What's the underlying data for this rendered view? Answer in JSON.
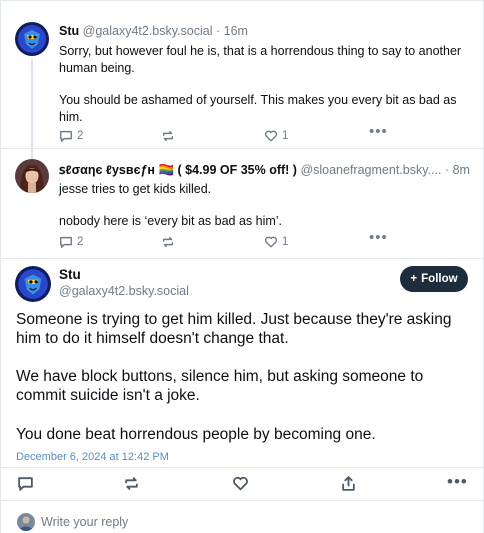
{
  "post1": {
    "name": "Stu",
    "handle": "@galaxy4t2.bsky.social",
    "dot": "·",
    "time": "16m",
    "paragraph1": "Sorry, but however foul he is, that is a horrendous thing to say to another human being.",
    "paragraph2": "You should be ashamed of yourself. This makes you every bit as bad as him.",
    "reply_count": "2",
    "like_count": "1"
  },
  "post2": {
    "name": "ꜱℓσαηє ℓуѕвєƒн 🏳️‍🌈 ( $4.99 OF 35% off! )",
    "handle": "@sloanefragment.bsky....",
    "dot": "·",
    "time": "8m",
    "paragraph1": "jesse tries to get kids killed.",
    "paragraph2": "nobody here is ‘every bit as bad as him’.",
    "reply_count": "2",
    "like_count": "1"
  },
  "main_post": {
    "name": "Stu",
    "handle": "@galaxy4t2.bsky.social",
    "follow_label": "Follow",
    "paragraph1": "Someone is trying to get him killed. Just because they're asking him to do it himself doesn't change that.",
    "paragraph2": "We have block buttons, silence him, but asking someone to commit suicide isn't a joke.",
    "paragraph3": "You done beat horrendous people by becoming one.",
    "date": "December 6, 2024 at 12:42 PM"
  },
  "reply_bar": {
    "placeholder": "Write your reply"
  },
  "icons": {
    "reply": "comment-icon",
    "repost": "repost-icon",
    "like": "heart-icon",
    "share": "share-icon",
    "more": "more-horizontal-icon",
    "follow": "plus-icon"
  },
  "colors": {
    "follow_button": "#1e2d3b",
    "date_link": "#5b8ac4",
    "muted_text": "#6f7b88"
  }
}
